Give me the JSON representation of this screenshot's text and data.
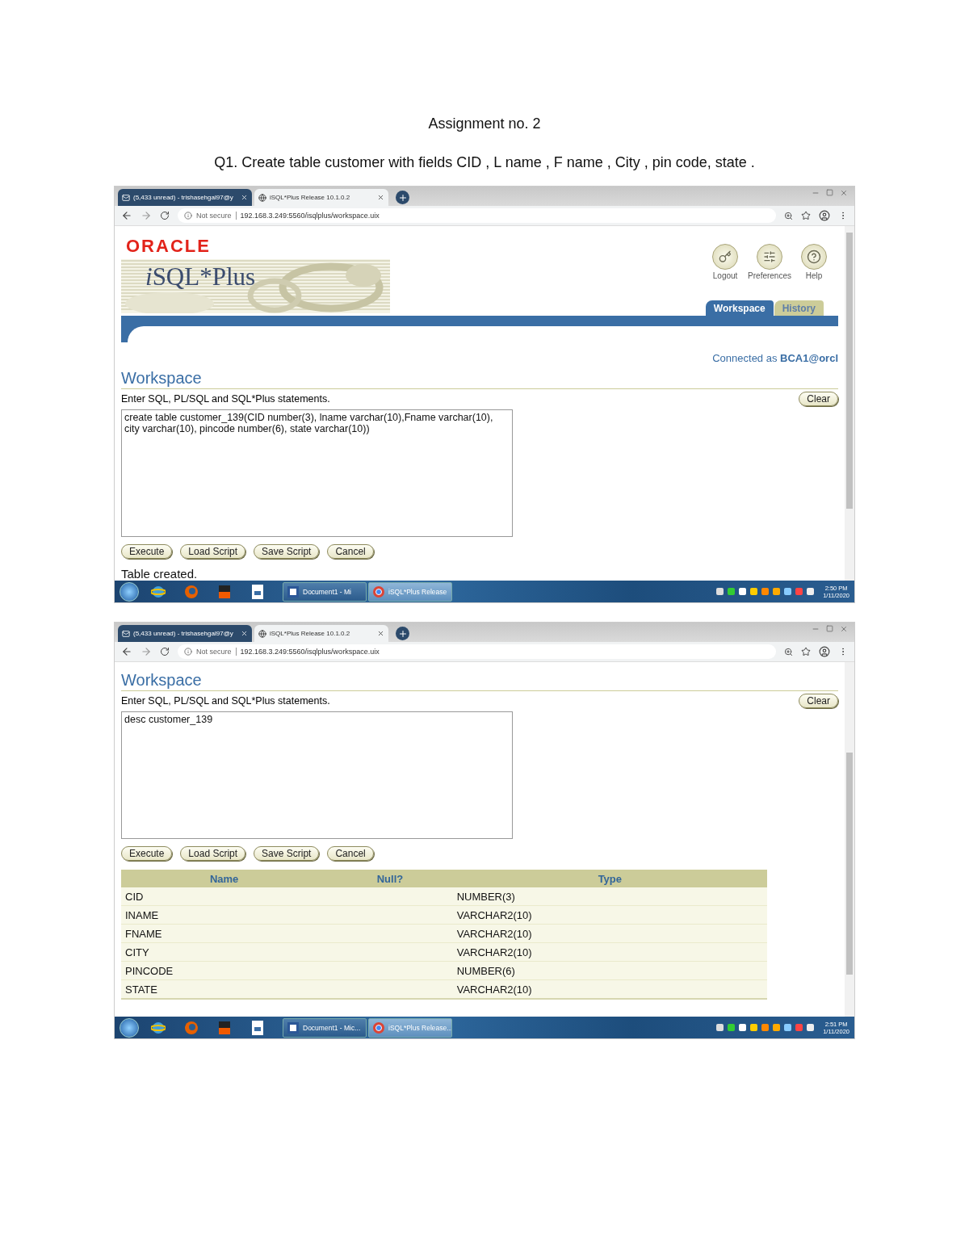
{
  "document": {
    "title": "Assignment no. 2",
    "question": "Q1. Create table customer with fields CID , L name , F name , City , pin code, state ."
  },
  "screenshots": [
    {
      "browser": {
        "tabs": [
          {
            "label": "(5,433 unread) - trishasehgal97@y",
            "selected": false
          },
          {
            "label": "iSQL*Plus Release 10.1.0.2",
            "selected": true
          }
        ],
        "address": {
          "security": "Not secure",
          "url": "192.168.3.249:5560/isqlplus/workspace.uix"
        }
      },
      "app": {
        "header": {
          "logo": "ORACLE",
          "product": "iSQL*Plus",
          "links": [
            {
              "label": "Logout",
              "kind": "logout"
            },
            {
              "label": "Preferences",
              "kind": "preferences"
            },
            {
              "label": "Help",
              "kind": "help"
            }
          ],
          "tabs": [
            {
              "label": "Workspace",
              "selected": true
            },
            {
              "label": "History",
              "selected": false
            }
          ],
          "connected_label": "Connected as",
          "connected_user": "BCA1@orcl"
        },
        "heading": "Workspace",
        "instruction": "Enter SQL, PL/SQL and SQL*Plus statements.",
        "clear": "Clear",
        "editor": "create table customer_139(CID number(3), lname varchar(10),Fname varchar(10), city varchar(10), pincode number(6), state varchar(10))",
        "buttons": [
          "Execute",
          "Load Script",
          "Save Script",
          "Cancel"
        ],
        "message": "Table created."
      },
      "taskbar": {
        "tasks": [
          {
            "label": "Document1 - Mi",
            "kind": "word",
            "selected": false
          },
          {
            "label": "iSQL*Plus Release",
            "kind": "chrome",
            "selected": true
          }
        ],
        "time": "2:50 PM",
        "date": "1/11/2020"
      }
    },
    {
      "browser": {
        "tabs": [
          {
            "label": "(5,433 unread) - trishasehgal97@y",
            "selected": false
          },
          {
            "label": "iSQL*Plus Release 10.1.0.2",
            "selected": true
          }
        ],
        "address": {
          "security": "Not secure",
          "url": "192.168.3.249:5560/isqlplus/workspace.uix"
        }
      },
      "app": {
        "heading": "Workspace",
        "instruction": "Enter SQL, PL/SQL and SQL*Plus statements.",
        "clear": "Clear",
        "editor": "desc customer_139",
        "buttons": [
          "Execute",
          "Load Script",
          "Save Script",
          "Cancel"
        ],
        "result": {
          "columns": [
            "Name",
            "Null?",
            "Type"
          ],
          "rows": [
            {
              "name": "CID",
              "type": "NUMBER(3)"
            },
            {
              "name": "INAME",
              "type": "VARCHAR2(10)"
            },
            {
              "name": "FNAME",
              "type": "VARCHAR2(10)"
            },
            {
              "name": "CITY",
              "type": "VARCHAR2(10)"
            },
            {
              "name": "PINCODE",
              "type": "NUMBER(6)"
            },
            {
              "name": "STATE",
              "type": "VARCHAR2(10)"
            }
          ]
        }
      },
      "taskbar": {
        "tasks": [
          {
            "label": "Document1 - Mic...",
            "kind": "word",
            "selected": false
          },
          {
            "label": "iSQL*Plus Release...",
            "kind": "chrome",
            "selected": true
          }
        ],
        "time": "2:51 PM",
        "date": "1/11/2020"
      }
    }
  ]
}
